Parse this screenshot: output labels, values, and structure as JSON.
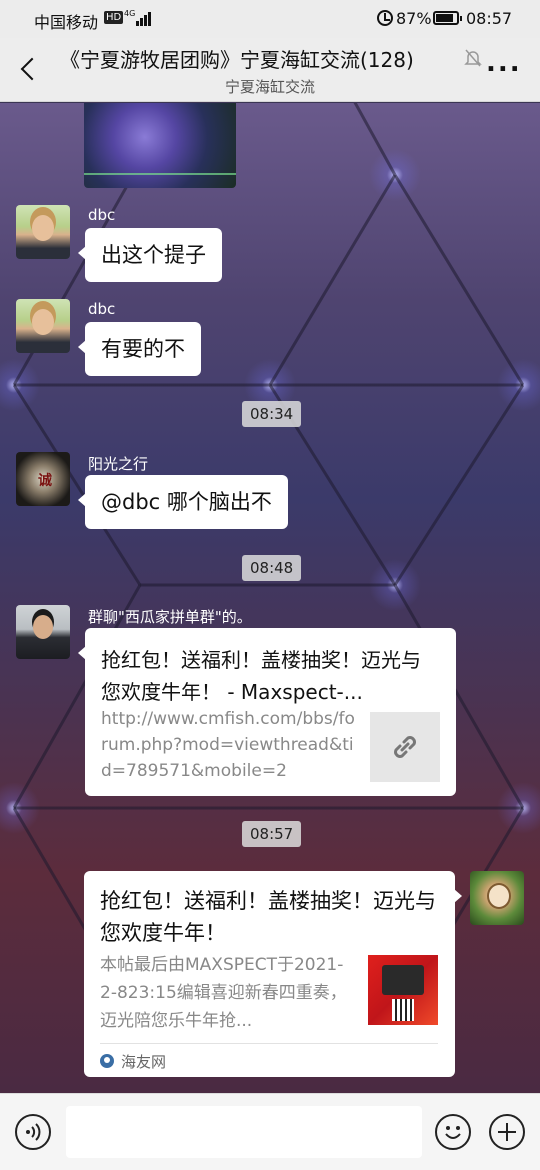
{
  "status_bar": {
    "carrier": "中国移动",
    "hd_badge": "HD",
    "network": "4G",
    "battery_percent": "87%",
    "battery_level": 0.87,
    "time": "08:57"
  },
  "header": {
    "title": "《宁夏游牧居团购》宁夏海缸交流(128)",
    "subtitle": "宁夏海缸交流",
    "more_label": "..."
  },
  "messages": [
    {
      "type": "image",
      "side": "left"
    },
    {
      "type": "text",
      "side": "left",
      "sender": "dbc",
      "text": "出这个提子",
      "avatar": "avatar-dbc"
    },
    {
      "type": "text",
      "side": "left",
      "sender": "dbc",
      "text": "有要的不",
      "avatar": "avatar-dbc"
    },
    {
      "type": "time",
      "text": "08:34"
    },
    {
      "type": "text",
      "side": "left",
      "sender": "阳光之行",
      "text": "@dbc  哪个脑出不",
      "avatar": "avatar-sun",
      "avatar_seal": "诚"
    },
    {
      "type": "time",
      "text": "08:48"
    },
    {
      "type": "link_card",
      "side": "left",
      "sender": "群聊\"西瓜家拼单群\"的。",
      "title": "抢红包！送福利！盖楼抽奖！迈光与您欢度牛年！ - Maxspect-...",
      "url": "http://www.cmfish.com/bbs/forum.php?mod=viewthread&tid=789571&mobile=2",
      "icon": "link-icon"
    },
    {
      "type": "time",
      "text": "08:57"
    },
    {
      "type": "article_card",
      "side": "right",
      "title": "抢红包！送福利！盖楼抽奖！迈光与您欢度牛年！",
      "desc": "本帖最后由MAXSPECT于2021-2-823:15编辑喜迎新春四重奏，迈光陪您乐牛年抢...",
      "source": "海友网",
      "icon": "source-icon"
    }
  ],
  "input_bar": {
    "placeholder": "",
    "voice_icon": "voice-icon",
    "emoji_icon": "emoji-icon",
    "plus_icon": "plus-icon"
  },
  "colors": {
    "bubble": "#ffffff",
    "header_bg": "#ededed",
    "timestamp_bg": "#dcdcdc"
  }
}
